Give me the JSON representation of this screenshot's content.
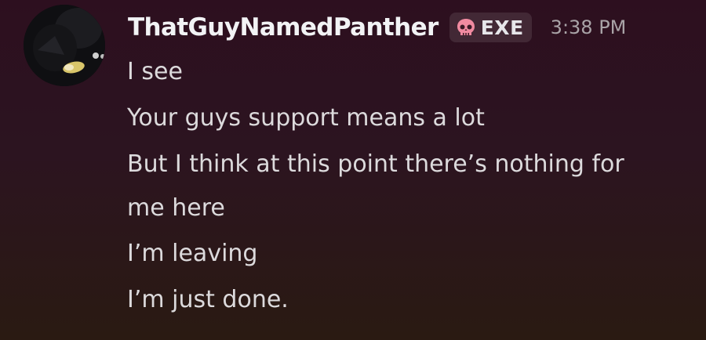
{
  "message": {
    "username": "ThatGuyNamedPanther",
    "role_tag": {
      "icon": "skull-icon",
      "label": "EXE",
      "icon_color": "#f08aa0"
    },
    "timestamp": "3:38 PM",
    "lines": [
      "I see",
      "Your guys support means a lot",
      "But I think at this point there’s nothing for me here",
      "I’m leaving",
      "I’m just done."
    ]
  },
  "colors": {
    "background_top": "#2d0f1f",
    "background_bottom": "#2a1a12",
    "username": "#f2f3f5",
    "text": "#dcdadc",
    "timestamp": "#a9a3a7"
  }
}
